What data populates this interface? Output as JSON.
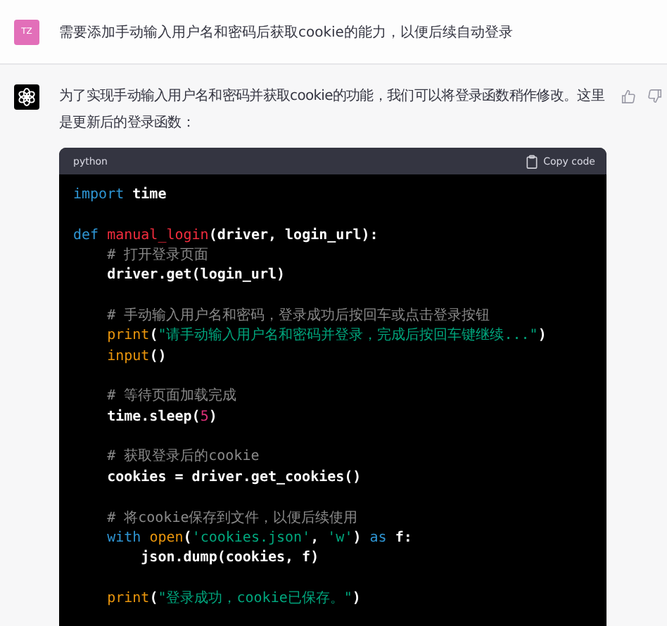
{
  "user_message": {
    "avatar": "TZ",
    "text": "需要添加手动输入用户名和密码后获取cookie的能力，以便后续自动登录"
  },
  "assistant_message": {
    "text": "为了实现手动输入用户名和密码并获取cookie的功能，我们可以将登录函数稍作修改。这里是更新后的登录函数：",
    "code_block": {
      "language": "python",
      "copy_label": "Copy code",
      "lines": [
        {
          "kind": "code",
          "tokens": [
            {
              "kind": "keyword",
              "text": "import"
            },
            {
              "kind": "plain",
              "text": " time"
            }
          ]
        },
        {
          "kind": "blank"
        },
        {
          "kind": "code",
          "tokens": [
            {
              "kind": "keyword",
              "text": "def"
            },
            {
              "kind": "function",
              "text": " manual_login"
            },
            {
              "kind": "plain",
              "text": "(driver, login_url):"
            }
          ]
        },
        {
          "kind": "code",
          "tokens": [
            {
              "kind": "comment",
              "text": "    # 打开登录页面"
            }
          ]
        },
        {
          "kind": "code",
          "tokens": [
            {
              "kind": "plain",
              "text": "    driver.get(login_url)"
            }
          ]
        },
        {
          "kind": "blank"
        },
        {
          "kind": "code",
          "tokens": [
            {
              "kind": "comment",
              "text": "    # 手动输入用户名和密码，登录成功后按回车或点击登录按钮"
            }
          ]
        },
        {
          "kind": "code",
          "tokens": [
            {
              "kind": "builtin",
              "text": "    print"
            },
            {
              "kind": "plain",
              "text": "("
            },
            {
              "kind": "string",
              "text": "\"请手动输入用户名和密码并登录，完成后按回车键继续...\""
            },
            {
              "kind": "plain",
              "text": ")"
            }
          ]
        },
        {
          "kind": "code",
          "tokens": [
            {
              "kind": "builtin",
              "text": "    input"
            },
            {
              "kind": "plain",
              "text": "()"
            }
          ]
        },
        {
          "kind": "blank"
        },
        {
          "kind": "code",
          "tokens": [
            {
              "kind": "comment",
              "text": "    # 等待页面加载完成"
            }
          ]
        },
        {
          "kind": "code",
          "tokens": [
            {
              "kind": "plain",
              "text": "    time.sleep("
            },
            {
              "kind": "number",
              "text": "5"
            },
            {
              "kind": "plain",
              "text": ")"
            }
          ]
        },
        {
          "kind": "blank"
        },
        {
          "kind": "code",
          "tokens": [
            {
              "kind": "comment",
              "text": "    # 获取登录后的cookie"
            }
          ]
        },
        {
          "kind": "code",
          "tokens": [
            {
              "kind": "plain",
              "text": "    cookies = driver.get_cookies()"
            }
          ]
        },
        {
          "kind": "blank"
        },
        {
          "kind": "code",
          "tokens": [
            {
              "kind": "comment",
              "text": "    # 将cookie保存到文件，以便后续使用"
            }
          ]
        },
        {
          "kind": "code",
          "tokens": [
            {
              "kind": "keyword",
              "text": "    with"
            },
            {
              "kind": "builtin",
              "text": " open"
            },
            {
              "kind": "plain",
              "text": "("
            },
            {
              "kind": "string",
              "text": "'cookies.json'"
            },
            {
              "kind": "plain",
              "text": ", "
            },
            {
              "kind": "string",
              "text": "'w'"
            },
            {
              "kind": "plain",
              "text": ") "
            },
            {
              "kind": "keyword",
              "text": "as"
            },
            {
              "kind": "plain",
              "text": " f:"
            }
          ]
        },
        {
          "kind": "code",
          "tokens": [
            {
              "kind": "plain",
              "text": "        json.dump(cookies, f)"
            }
          ]
        },
        {
          "kind": "blank"
        },
        {
          "kind": "code",
          "tokens": [
            {
              "kind": "builtin",
              "text": "    print"
            },
            {
              "kind": "plain",
              "text": "("
            },
            {
              "kind": "string",
              "text": "\"登录成功，cookie已保存。\""
            },
            {
              "kind": "plain",
              "text": ")"
            }
          ]
        }
      ]
    }
  }
}
